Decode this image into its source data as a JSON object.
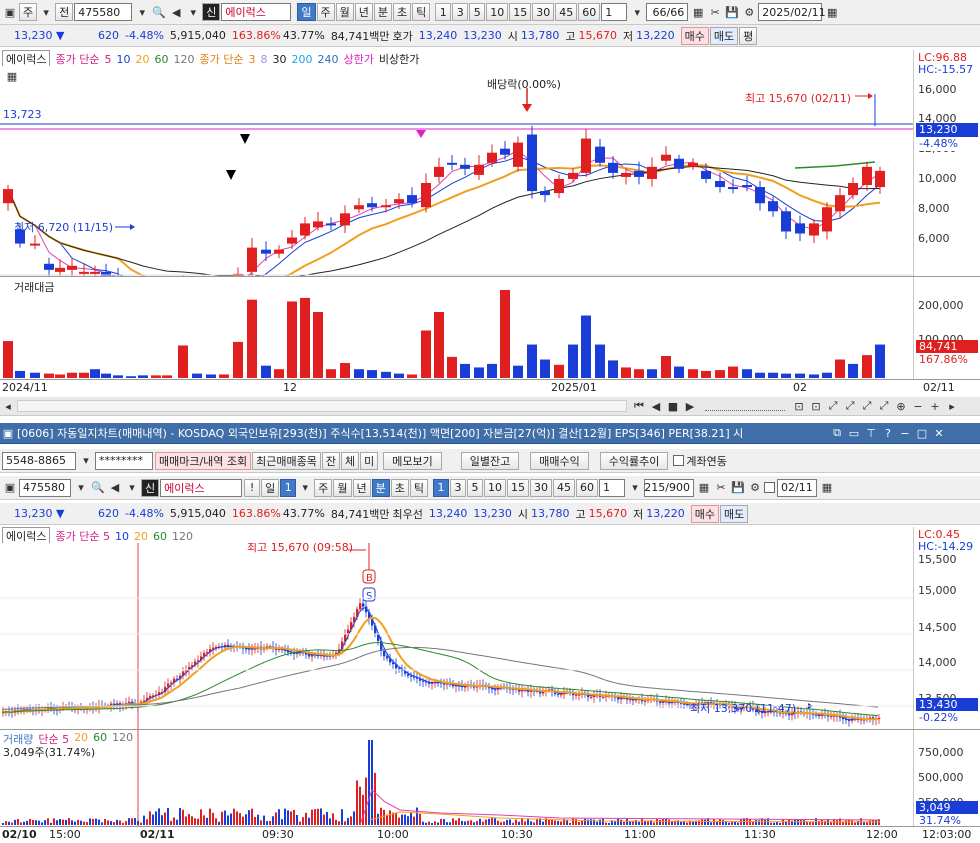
{
  "top": {
    "market_label": "주",
    "jeon_label": "전",
    "code": "475580",
    "shin": "신",
    "name": "에이럭스",
    "periods": [
      "일",
      "주",
      "월",
      "년",
      "분",
      "초",
      "틱"
    ],
    "period_selected": "일",
    "nums": [
      "1",
      "3",
      "5",
      "10",
      "15",
      "30",
      "45",
      "60"
    ],
    "count_val": "1",
    "range": "66/66",
    "date": "2025/02/11"
  },
  "quote": {
    "price": "13,230 ▼",
    "change": "620",
    "pct": "-4.48%",
    "volume": "5,915,040",
    "vol_pct": "163.86%",
    "turnover": "43.77%",
    "amount": "84,741백만",
    "hoga_label": "호가",
    "hoga1": "13,240",
    "hoga2": "13,230",
    "si_label": "시",
    "si": "13,780",
    "go_label": "고",
    "go": "15,670",
    "jeo_label": "저",
    "jeo": "13,220",
    "buy": "매수",
    "sell": "매도",
    "pyeong": "평"
  },
  "daily_legend": {
    "name": "에이럭스",
    "ma_label": "종가 단순",
    "ma": [
      "5",
      "10",
      "20",
      "60",
      "120"
    ],
    "ma2_label": "종가 단순",
    "ma2": [
      "3",
      "8",
      "30",
      "200",
      "240"
    ],
    "limit_up": "상한가",
    "limit_updown": "비상한가"
  },
  "daily_chart": {
    "left_level": "13,723",
    "high_label": "최고 15,670 (02/11)",
    "low_label": "최저 6,720 (11/15)",
    "div_label": "배당락(0.00%)",
    "lc": "LC:96.88",
    "hc": "HC:-15.57",
    "price_tag": "13,230",
    "pct_tag": "-4.48%",
    "y_ticks": [
      "16,000",
      "14,000",
      "12,000",
      "10,000",
      "8,000",
      "6,000"
    ],
    "vol_title": "거래대금",
    "vol_ticks": [
      "200,000",
      "100,000"
    ],
    "vol_tag": "84,741",
    "vol_pct_tag": "167.86%",
    "x_ticks": [
      "2024/11",
      "12",
      "2025/01",
      "02"
    ],
    "x_right": "02/11"
  },
  "minute_window": {
    "title": "[0606] 자동일지차트(매매내역) - KOSDAQ 외국인보유[293(천)] 주식수[13,514(천)] 액면[200] 자본금[27(억)] 결산[12월] EPS[346] PER[38.21] 시",
    "account": "5548-8865",
    "password": "********",
    "btn_mark": "매매마크/내역 조회",
    "btn_recent": "최근매매종목",
    "btn_jan": "잔",
    "btn_che": "체",
    "btn_mi": "미",
    "btn_memo": "메모보기",
    "btn_daily": "일별잔고",
    "btn_profit": "매매수익",
    "btn_rate": "수익률추이",
    "chk_link": "계좌연동",
    "code": "475580",
    "shin": "신",
    "name": "에이럭스",
    "periods": [
      "일",
      "주",
      "월",
      "년",
      "분",
      "초",
      "틱"
    ],
    "period_selected": "분",
    "nums": [
      "1",
      "3",
      "5",
      "10",
      "15",
      "30",
      "45",
      "60"
    ],
    "count_val": "1",
    "range": "215/900",
    "date": "02/11",
    "quote_best": "최우선",
    "legend_name": "에이럭스",
    "legend_ma": "종가 단순 5",
    "legend_ma_vals": [
      "10",
      "20",
      "60",
      "120"
    ],
    "high_label": "최고 15,670 (09:58)",
    "low_label": "최저 13,370 (11:47)",
    "lc": "LC:0.45",
    "hc": "HC:-14.29",
    "y_ticks": [
      "15,500",
      "15,000",
      "14,500",
      "14,000",
      "13,500"
    ],
    "price_tag": "13,430",
    "pct_tag": "-0.22%",
    "vol_legend": "거래량",
    "vol_legend_ma": "단순 5",
    "vol_legend_vals": [
      "20",
      "60",
      "120"
    ],
    "vol_stat": "3,049주(31.74%)",
    "vol_ticks": [
      "750,000",
      "500,000",
      "250,000"
    ],
    "vol_tag": "3,049",
    "vol_pct_tag": "31.74%",
    "x_ticks": [
      "02/10",
      "15:00",
      "02/11",
      "09:30",
      "10:00",
      "10:30",
      "11:00",
      "11:30",
      "12:00"
    ],
    "x_right": "12:03:00"
  },
  "colors": {
    "up": "#e02020",
    "down": "#1a3dd8",
    "ma5": "#e040b0",
    "ma20": "#f0a020",
    "ma60": "#2a8a2a",
    "ma120": "#777777",
    "accent": "#3f79c8"
  }
}
